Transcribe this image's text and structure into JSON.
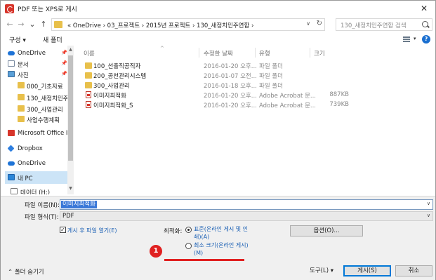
{
  "window": {
    "title": "PDF 또는 XPS로 게시",
    "close_label": "✕"
  },
  "nav": {
    "back": "←",
    "forward": "→",
    "dropdown": "⌄",
    "up": "↑",
    "address": "« OneDrive › 03_프로젝트 › 2015년 프로젝트 › 130_새정치민주연합 ›",
    "address_dropdown": "∨",
    "refresh": "↻",
    "search_placeholder": "130_새정치민주연합 검색"
  },
  "toolbar": {
    "organize": "구성 ▾",
    "new_folder": "새 폴더",
    "view_dropdown": "▾",
    "help": "?"
  },
  "sidebar": {
    "items": [
      {
        "label": "OneDrive",
        "icon": "cloud-icon",
        "pinned": true
      },
      {
        "label": "문서",
        "icon": "document-icon",
        "pinned": true
      },
      {
        "label": "사진",
        "icon": "picture-icon",
        "pinned": true
      },
      {
        "label": "000_기초자료",
        "icon": "folder-icon"
      },
      {
        "label": "130_새정치민주",
        "icon": "folder-icon"
      },
      {
        "label": "300_사업관리",
        "icon": "folder-icon"
      },
      {
        "label": "사업수행계획",
        "icon": "folder-icon"
      },
      {
        "label": "Microsoft Office I",
        "icon": "office-icon"
      },
      {
        "label": "Dropbox",
        "icon": "dropbox-icon"
      },
      {
        "label": "OneDrive",
        "icon": "cloud-icon"
      },
      {
        "label": "내 PC",
        "icon": "computer-icon",
        "selected": true
      },
      {
        "label": "데이터 (H:)",
        "icon": "drive-icon"
      }
    ],
    "pin_glyph": "📌"
  },
  "filelist": {
    "columns": {
      "name": "이름",
      "date": "수정한 날짜",
      "type": "유형",
      "size": "크기"
    },
    "sort_caret": "^",
    "rows": [
      {
        "name": "100_선출직공직자",
        "date": "2016-01-20 오후...",
        "type": "파일 폴더",
        "size": "",
        "kind": "folder"
      },
      {
        "name": "200_공천관리시스템",
        "date": "2016-01-07 오전...",
        "type": "파일 폴더",
        "size": "",
        "kind": "folder"
      },
      {
        "name": "300_사업관리",
        "date": "2016-01-18 오후...",
        "type": "파일 폴더",
        "size": "",
        "kind": "folder"
      },
      {
        "name": "이미지최적화",
        "date": "2016-01-20 오후...",
        "type": "Adobe Acrobat 문...",
        "size": "887KB",
        "kind": "pdf"
      },
      {
        "name": "이미지최적화_S",
        "date": "2016-01-20 오후...",
        "type": "Adobe Acrobat 문...",
        "size": "739KB",
        "kind": "pdf"
      }
    ]
  },
  "form": {
    "filename_label": "파일 이름(N):",
    "filename_value": "이미지최적화",
    "filetype_label": "파일 형식(T):",
    "filetype_value": "PDF",
    "open_after": "게시 후 파일 열기(E)",
    "optimize_label": "최적화:",
    "option_standard": "표준(온라인 게시 및 인쇄)(A)",
    "option_minimum": "최소 크기(온라인 게시)(M)",
    "options_button": "옵션(O)..."
  },
  "footer": {
    "hide_folders": "⌃ 폴더 숨기기",
    "tools": "도구(L) ▾",
    "publish": "게시(S)",
    "cancel": "취소"
  },
  "annotation": {
    "marker": "1",
    "color": "#e02020"
  }
}
